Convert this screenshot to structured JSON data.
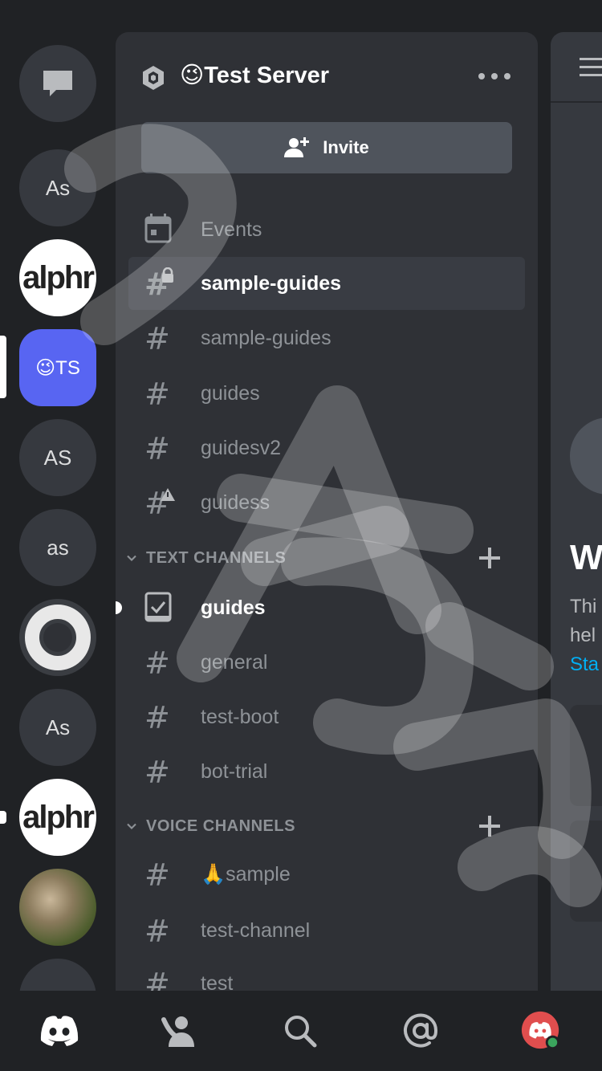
{
  "servers": [
    {
      "label": ""
    },
    {
      "label": "As"
    },
    {
      "label": "alphr"
    },
    {
      "label": "😉TS",
      "active": true
    },
    {
      "label": "AS"
    },
    {
      "label": "as"
    },
    {
      "label": ""
    },
    {
      "label": "As"
    },
    {
      "label": "alphr"
    },
    {
      "label": ""
    }
  ],
  "server": {
    "name": "😉Test Server",
    "invite_label": "Invite"
  },
  "channels": {
    "events": "Events",
    "top": [
      "sample-guides",
      "sample-guides",
      "guides",
      "guidesv2",
      "guidess"
    ],
    "text_category": "TEXT CHANNELS",
    "text": [
      "guides",
      "general",
      "test-boot",
      "bot-trial"
    ],
    "voice_category": "VOICE CHANNELS",
    "voice": [
      "🙏sample",
      "test-channel",
      "test"
    ]
  },
  "main_peek": {
    "heading": "W",
    "line1": "Thi",
    "line2": "hel",
    "link": "Sta"
  },
  "watermark": "Alphr",
  "colors": {
    "accent": "#5865f2",
    "background": "#202225",
    "panel": "#2f3136",
    "link": "#00aff4",
    "online": "#3ba55d"
  }
}
